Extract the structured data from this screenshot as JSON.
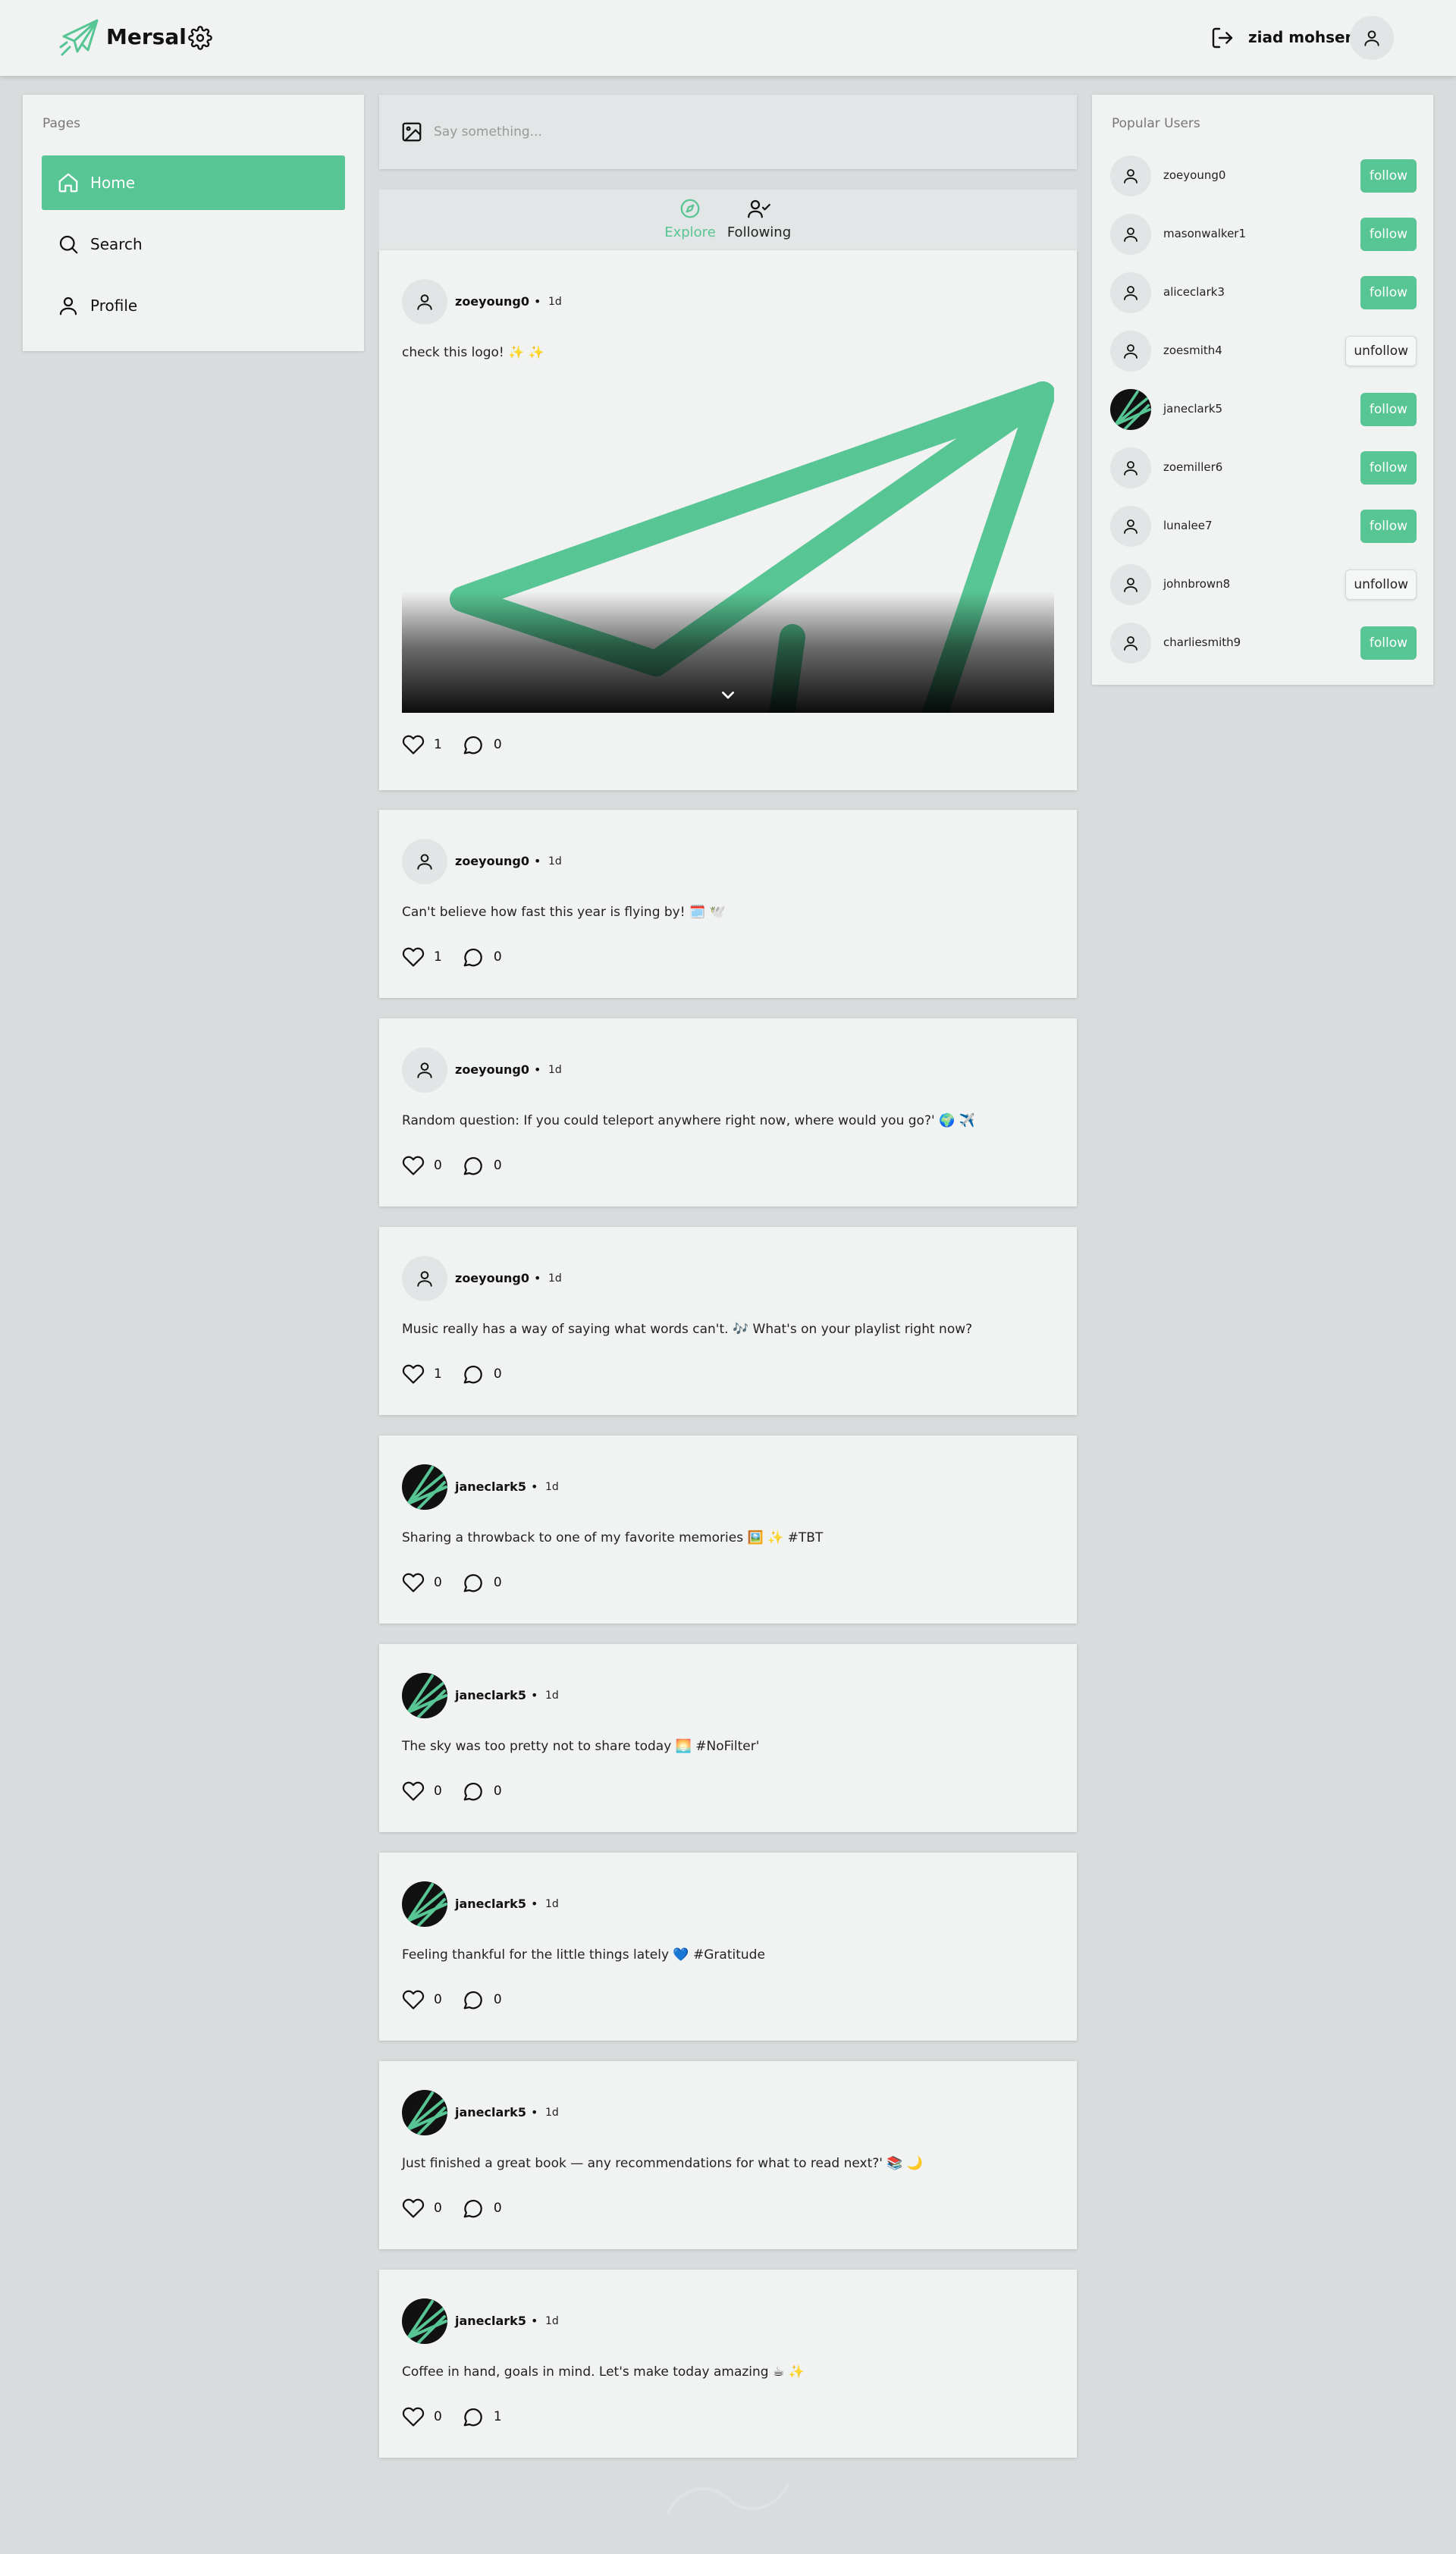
{
  "app": {
    "name": "Mersal",
    "user_name": "ziad mohsen",
    "accent_color": "#57c594",
    "icons": {
      "logo": "paper-plane-icon",
      "settings": "gear-icon",
      "logout": "logout-icon",
      "avatar": "user-icon"
    }
  },
  "sidebar": {
    "title": "Pages",
    "items": [
      {
        "label": "Home",
        "icon": "home-icon",
        "active": true
      },
      {
        "label": "Search",
        "icon": "search-icon",
        "active": false
      },
      {
        "label": "Profile",
        "icon": "user-icon",
        "active": false
      }
    ]
  },
  "composer": {
    "placeholder": "Say something...",
    "icon": "image-icon"
  },
  "feed_tabs": [
    {
      "label": "Explore",
      "icon": "compass-icon",
      "active": true
    },
    {
      "label": "Following",
      "icon": "user-check-icon",
      "active": false
    }
  ],
  "posts": [
    {
      "user": "zoeyoung0",
      "separator": "•",
      "time": "1d",
      "text": "check this logo! ✨ ✨",
      "likes": "1",
      "comments": "0",
      "has_image": true,
      "image_caption": "paper-plane-logo"
    },
    {
      "user": "zoeyoung0",
      "separator": "•",
      "time": "1d",
      "text": "Can't believe how fast this year is flying by! 🗓️ 🕊️",
      "likes": "1",
      "comments": "0"
    },
    {
      "user": "zoeyoung0",
      "separator": "•",
      "time": "1d",
      "text": "Random question: If you could teleport anywhere right now, where would you go?' 🌍 ✈️",
      "likes": "0",
      "comments": "0"
    },
    {
      "user": "zoeyoung0",
      "separator": "•",
      "time": "1d",
      "text": "Music really has a way of saying what words can't. 🎶 What's on your playlist right now?",
      "likes": "1",
      "comments": "0"
    },
    {
      "user": "janeclark5",
      "separator": "•",
      "time": "1d",
      "text": "Sharing a throwback to one of my favorite memories 🖼️ ✨ #TBT",
      "likes": "0",
      "comments": "0"
    },
    {
      "user": "janeclark5",
      "separator": "•",
      "time": "1d",
      "text": "The sky was too pretty not to share today 🌅 #NoFilter'",
      "likes": "0",
      "comments": "0"
    },
    {
      "user": "janeclark5",
      "separator": "•",
      "time": "1d",
      "text": "Feeling thankful for the little things lately 💙 #Gratitude",
      "likes": "0",
      "comments": "0"
    },
    {
      "user": "janeclark5",
      "separator": "•",
      "time": "1d",
      "text": "Just finished a great book — any recommendations for what to read next?' 📚 🌙",
      "likes": "0",
      "comments": "0"
    },
    {
      "user": "janeclark5",
      "separator": "•",
      "time": "1d",
      "text": "Coffee in hand, goals in mind. Let's make today amazing ☕ ✨",
      "likes": "0",
      "comments": "1"
    }
  ],
  "popular_users": {
    "title": "Popular Users",
    "users": [
      {
        "name": "zoeyoung0",
        "action": "follow"
      },
      {
        "name": "masonwalker1",
        "action": "follow"
      },
      {
        "name": "aliceclark3",
        "action": "follow"
      },
      {
        "name": "zoesmith4",
        "action": "unfollow"
      },
      {
        "name": "janeclark5",
        "action": "follow"
      },
      {
        "name": "zoemiller6",
        "action": "follow"
      },
      {
        "name": "lunalee7",
        "action": "follow"
      },
      {
        "name": "johnbrown8",
        "action": "unfollow"
      },
      {
        "name": "charliesmith9",
        "action": "follow"
      }
    ]
  }
}
